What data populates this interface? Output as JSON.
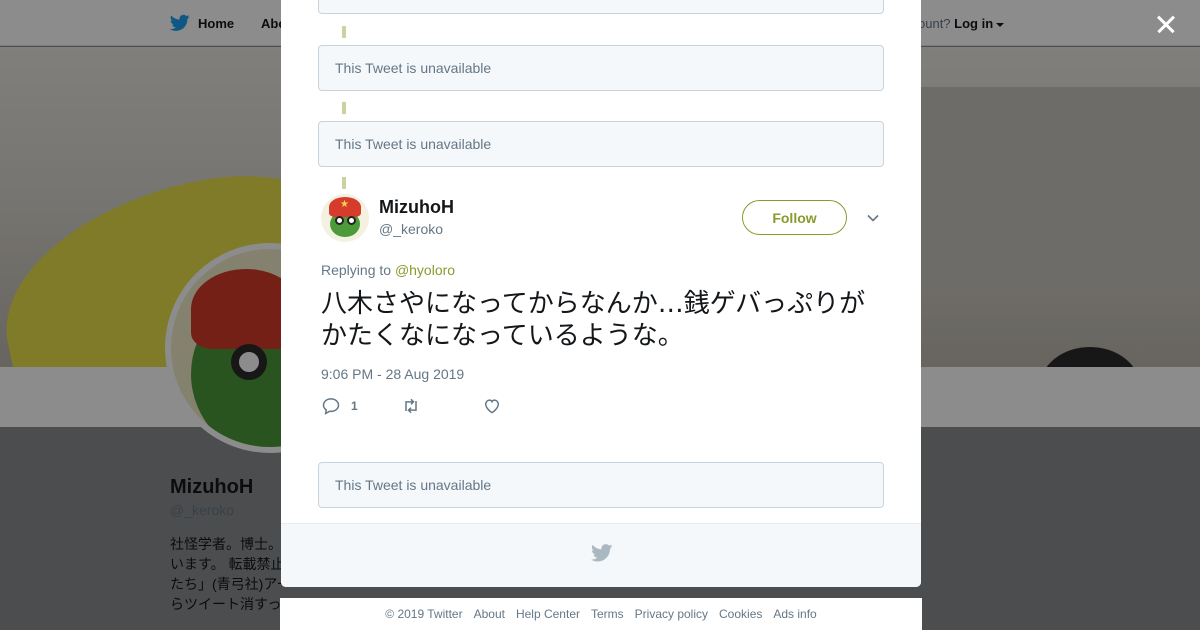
{
  "nav": {
    "home_label": "Home",
    "about_label": "Abo",
    "account_prompt": "ccount?",
    "login_label": "Log in"
  },
  "background_profile": {
    "name": "MizuhoH",
    "handle": "@_keroko",
    "bio_lines": [
      "社怪学者。博士。",
      "います。 転載禁止",
      "たち」(青弓社)アー",
      "らツイート消すっ"
    ]
  },
  "thread": {
    "unavailable_text": "This Tweet is unavailable"
  },
  "tweet": {
    "name": "MizuhoH",
    "handle": "@_keroko",
    "follow_label": "Follow",
    "replying_prefix": "Replying to",
    "replying_handle": "@hyoloro",
    "text": "八木さやになってからなんか…銭ゲバっぷりがかたくなになっているような。",
    "timestamp": "9:06 PM - 28 Aug 2019",
    "reply_count": "1",
    "accent_color": "#8a9a2e"
  },
  "footer": {
    "links": [
      "© 2019 Twitter",
      "About",
      "Help Center",
      "Terms",
      "Privacy policy",
      "Cookies",
      "Ads info"
    ]
  },
  "icons": {
    "twitter_bird": "twitter-bird-icon",
    "close": "close-icon",
    "reply": "reply-icon",
    "retweet": "retweet-icon",
    "like": "heart-icon",
    "chevron": "chevron-down-icon"
  }
}
